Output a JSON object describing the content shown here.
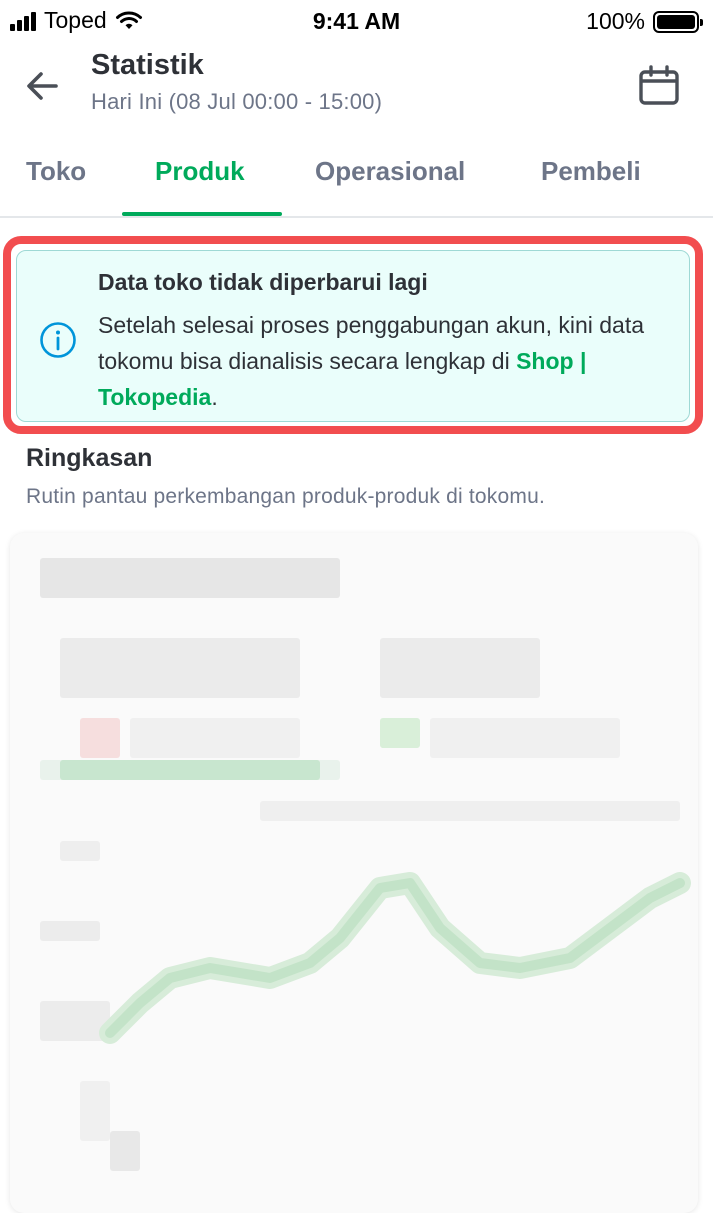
{
  "status_bar": {
    "carrier": "Toped",
    "time": "9:41 AM",
    "battery_percent": "100%"
  },
  "header": {
    "title": "Statistik",
    "subtitle": "Hari Ini (08 Jul 00:00 - 15:00)",
    "back_icon": "arrow-left-icon",
    "calendar_icon": "calendar-icon"
  },
  "tabs": [
    {
      "label": "Toko",
      "active": false
    },
    {
      "label": "Produk",
      "active": true
    },
    {
      "label": "Operasional",
      "active": false
    },
    {
      "label": "Pembeli",
      "active": false
    }
  ],
  "ticker": {
    "icon": "info-icon",
    "title": "Data toko tidak diperbarui lagi",
    "body_prefix": "Setelah selesai proses penggabungan akun, kini data tokomu bisa dianalisis secara lengkap di ",
    "link_text": "Shop | Tokopedia",
    "body_suffix": "."
  },
  "summary": {
    "title": "Ringkasan",
    "description": "Rutin pantau perkembangan produk-produk di tokomu."
  },
  "colors": {
    "brand_green": "#00aa5b",
    "highlight_red": "#f24d4f",
    "ticker_bg": "#eafefb",
    "text_primary": "#2e3137",
    "text_secondary": "#6d7588"
  }
}
